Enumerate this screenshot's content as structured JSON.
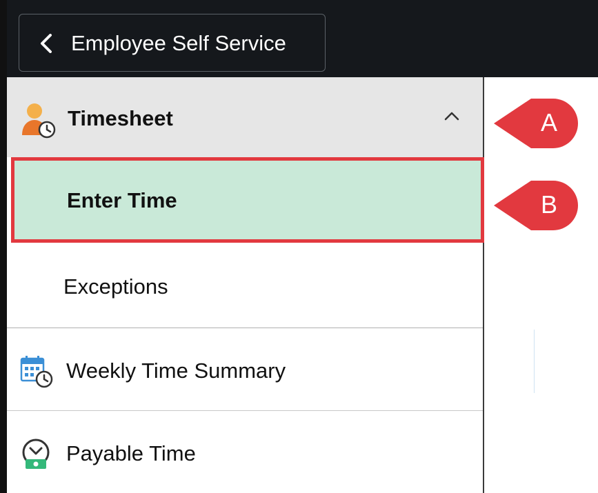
{
  "header": {
    "back_label": "Employee Self Service"
  },
  "sidebar": {
    "group": {
      "label": "Timesheet",
      "expanded": true,
      "icon": "person-clock-icon",
      "items": [
        {
          "label": "Enter Time",
          "selected": true
        },
        {
          "label": "Exceptions",
          "selected": false
        }
      ]
    },
    "items": [
      {
        "label": "Weekly Time Summary",
        "icon": "calendar-clock-icon"
      },
      {
        "label": "Payable Time",
        "icon": "clock-money-icon"
      }
    ]
  },
  "callouts": [
    {
      "letter": "A"
    },
    {
      "letter": "B"
    }
  ],
  "colors": {
    "header_bg": "#15181c",
    "group_bg": "#e6e6e6",
    "selected_bg": "#c9e9d8",
    "highlight_border": "#e2393f",
    "callout_red": "#e2393f"
  }
}
